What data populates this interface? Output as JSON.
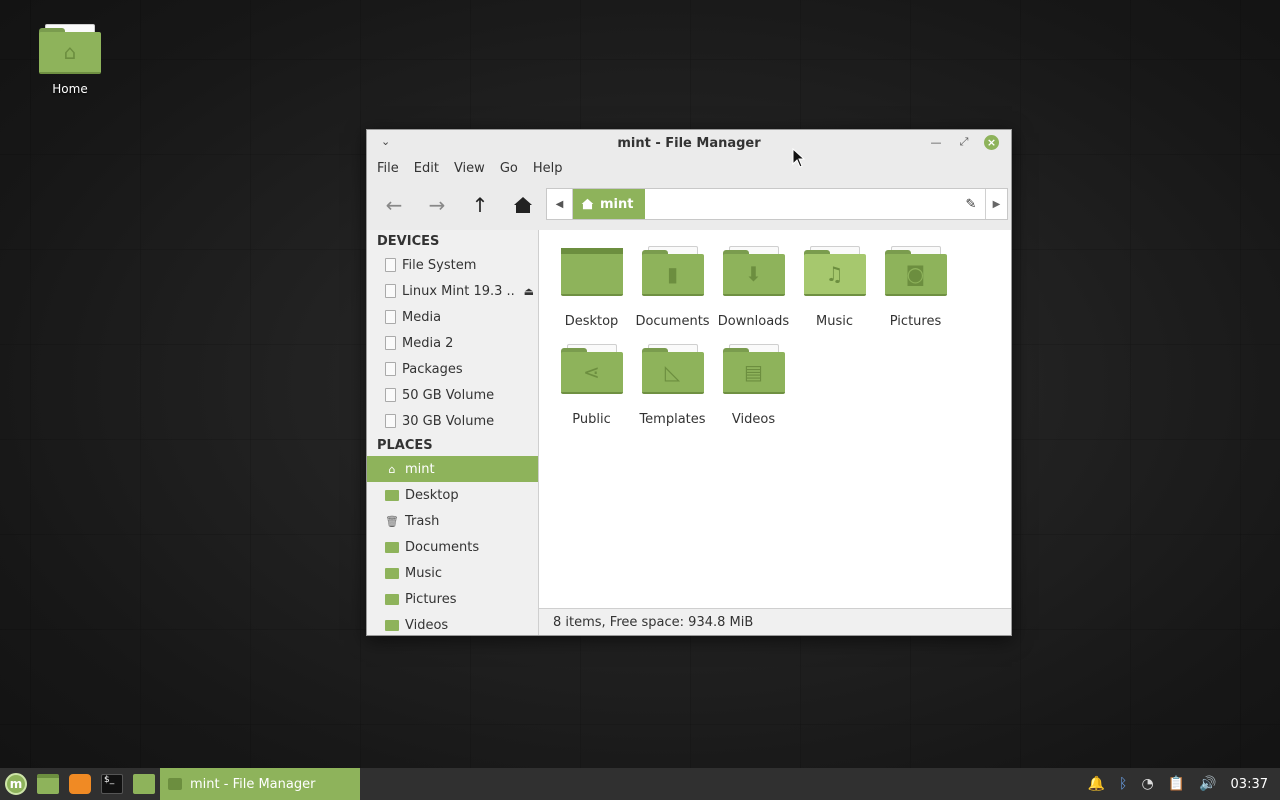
{
  "desktop": {
    "icons": [
      {
        "label": "Home",
        "icon": "home-folder-icon"
      }
    ]
  },
  "window": {
    "title": "mint - File Manager",
    "menu": [
      "File",
      "Edit",
      "View",
      "Go",
      "Help"
    ],
    "toolbar": {
      "back": "←",
      "forward": "→",
      "up": "↑",
      "home": "home-icon"
    },
    "pathbar": {
      "crumb": "mint"
    },
    "sidebar": {
      "devices_header": "DEVICES",
      "devices": [
        {
          "label": "File System"
        },
        {
          "label": "Linux Mint 19.3 ...",
          "ejectable": true
        },
        {
          "label": "Media"
        },
        {
          "label": "Media 2"
        },
        {
          "label": "Packages"
        },
        {
          "label": "50 GB Volume"
        },
        {
          "label": "30 GB Volume"
        }
      ],
      "places_header": "PLACES",
      "places": [
        {
          "label": "mint",
          "icon": "home-icon",
          "active": true
        },
        {
          "label": "Desktop",
          "icon": "desktop-folder-icon"
        },
        {
          "label": "Trash",
          "icon": "trash-icon"
        },
        {
          "label": "Documents",
          "icon": "documents-folder-icon"
        },
        {
          "label": "Music",
          "icon": "music-folder-icon"
        },
        {
          "label": "Pictures",
          "icon": "pictures-folder-icon"
        },
        {
          "label": "Videos",
          "icon": "videos-folder-icon"
        }
      ]
    },
    "files": [
      {
        "name": "Desktop",
        "icon": "desktop-folder-icon"
      },
      {
        "name": "Documents",
        "icon": "documents-folder-icon"
      },
      {
        "name": "Downloads",
        "icon": "downloads-folder-icon"
      },
      {
        "name": "Music",
        "icon": "music-folder-icon"
      },
      {
        "name": "Pictures",
        "icon": "pictures-folder-icon"
      },
      {
        "name": "Public",
        "icon": "public-folder-icon"
      },
      {
        "name": "Templates",
        "icon": "templates-folder-icon"
      },
      {
        "name": "Videos",
        "icon": "videos-folder-icon"
      }
    ],
    "status": "8 items, Free space: 934.8 MiB"
  },
  "taskbar": {
    "task_label": "mint - File Manager",
    "clock": "03:37"
  },
  "colors": {
    "accent": "#8eb35b",
    "panel": "#303030"
  }
}
